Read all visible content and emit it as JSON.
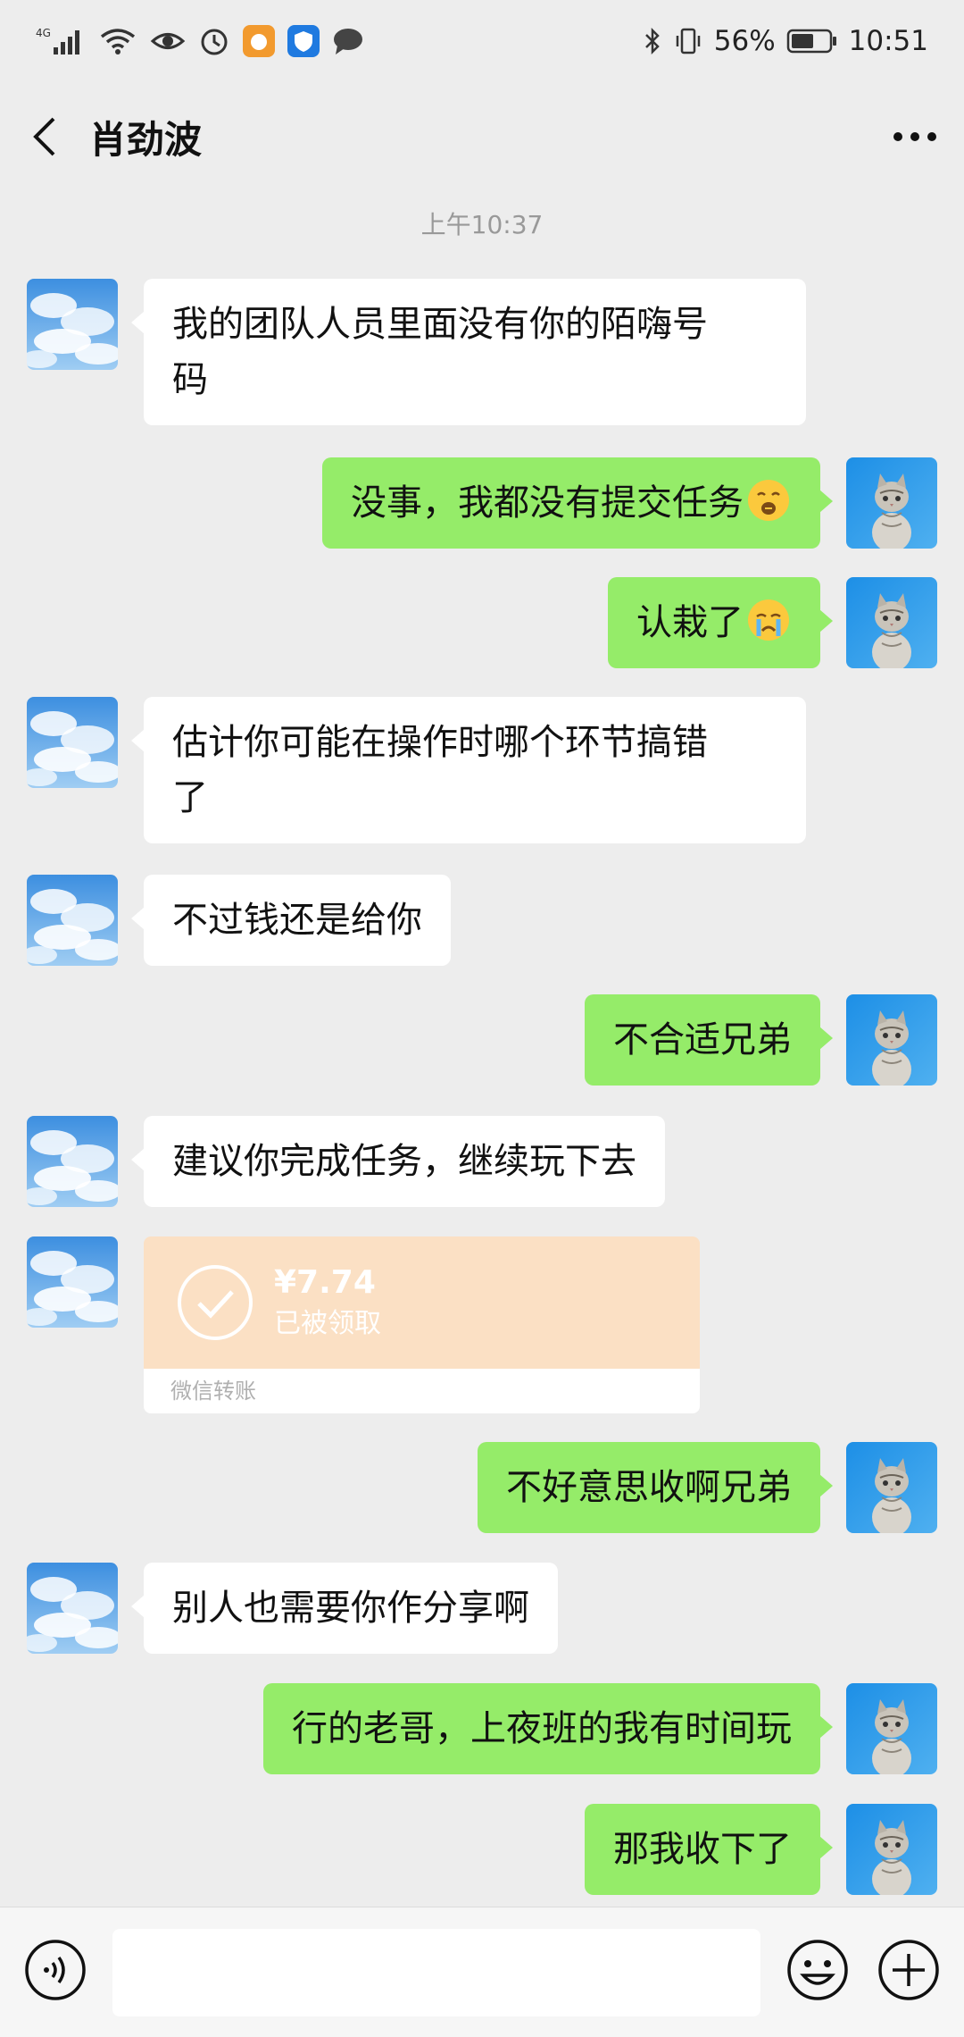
{
  "status_bar": {
    "network": "4G",
    "battery": "56%",
    "time": "10:51"
  },
  "header": {
    "title": "肖劲波",
    "back_icon": "chevron-left-icon",
    "more_icon": "more-dots-icon"
  },
  "chat": {
    "timestamp": "上午10:37",
    "messages": [
      {
        "from": "in",
        "text_lines": [
          "我的团队人员里面没有你的陌嗨号",
          "码"
        ]
      },
      {
        "from": "out",
        "text": "没事，我都没有提交任务",
        "emoji": "zipper-mouth-emoji"
      },
      {
        "from": "out",
        "text": "认栽了",
        "emoji": "crying-face-emoji"
      },
      {
        "from": "in",
        "text_lines": [
          "估计你可能在操作时哪个环节搞错",
          "了"
        ]
      },
      {
        "from": "in",
        "text": "不过钱还是给你"
      },
      {
        "from": "out",
        "text": "不合适兄弟"
      },
      {
        "from": "in",
        "text": "建议你完成任务，继续玩下去"
      },
      {
        "from": "in",
        "type": "transfer",
        "amount": "¥7.74",
        "status": "已被领取",
        "footer": "微信转账"
      },
      {
        "from": "out",
        "text": "不好意思收啊兄弟"
      },
      {
        "from": "in",
        "text": "别人也需要你作分享啊"
      },
      {
        "from": "out",
        "text": "行的老哥，上夜班的我有时间玩"
      },
      {
        "from": "out",
        "text": "那我收下了"
      }
    ]
  },
  "input_bar": {
    "voice_icon": "voice-icon",
    "emoji_icon": "emoji-icon",
    "plus_icon": "plus-icon",
    "placeholder": ""
  },
  "colors": {
    "background": "#ededed",
    "outgoing_bubble": "#95ec69",
    "incoming_bubble": "#ffffff",
    "transfer_card": "#fbe0c4"
  }
}
